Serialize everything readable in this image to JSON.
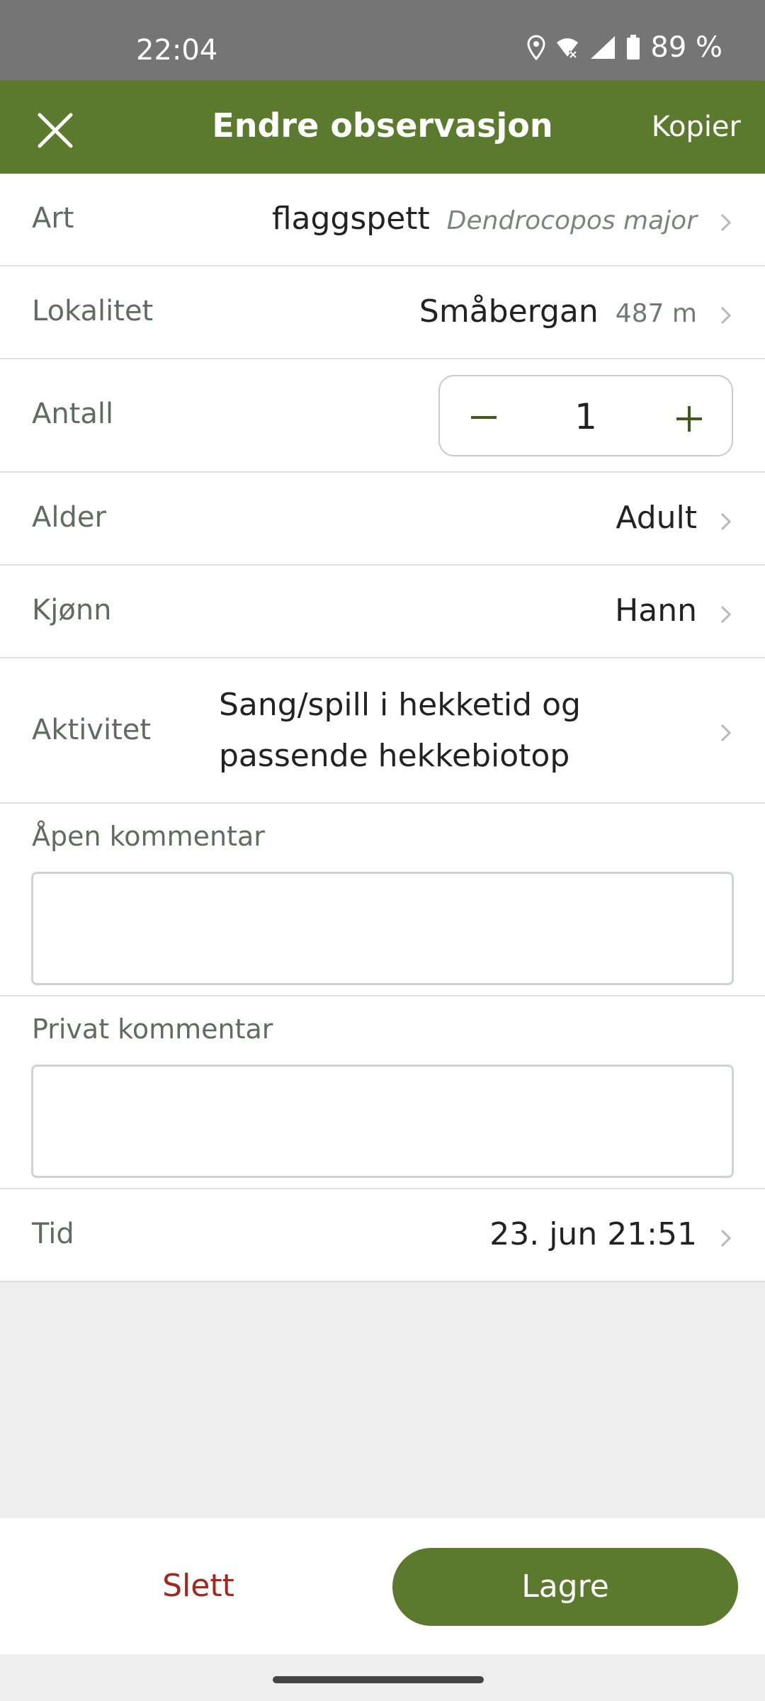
{
  "status_bar": {
    "time": "22:04",
    "battery": "89 %"
  },
  "app_bar": {
    "title": "Endre observasjon",
    "copy_label": "Kopier",
    "close_icon": "close-icon"
  },
  "form": {
    "species": {
      "label": "Art",
      "name": "flaggspett",
      "latin": "Dendrocopos major"
    },
    "locality": {
      "label": "Lokalitet",
      "name": "Småbergan",
      "distance": "487 m"
    },
    "count": {
      "label": "Antall",
      "value": "1"
    },
    "age": {
      "label": "Alder",
      "value": "Adult"
    },
    "sex": {
      "label": "Kjønn",
      "value": "Hann"
    },
    "activity": {
      "label": "Aktivitet",
      "line1": "Sang/spill i hekketid og",
      "line2": "passende hekkebiotop"
    },
    "open_comment": {
      "label": "Åpen kommentar",
      "value": ""
    },
    "private_comment": {
      "label": "Privat kommentar",
      "value": ""
    },
    "time": {
      "label": "Tid",
      "value": "23. jun 21:51"
    }
  },
  "actions": {
    "delete_label": "Slett",
    "save_label": "Lagre"
  },
  "colors": {
    "brand_green": "#5b7a2e",
    "delete_red": "#a3271f"
  }
}
